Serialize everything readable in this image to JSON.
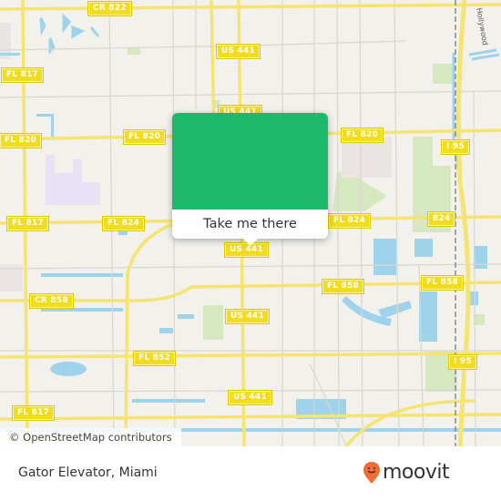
{
  "map": {
    "attribution": "© OpenStreetMap contributors",
    "colors": {
      "land": "#f2f1ec",
      "road_major": "#f6e470",
      "road_minor": "#d9d6cf",
      "water": "#9fd3ec",
      "park": "#d6e8bf",
      "shield": "#f1dc1e",
      "rail": "#8a8a8a"
    },
    "road_shields": [
      {
        "id": "cr822",
        "label": "CR 822"
      },
      {
        "id": "us441-a",
        "label": "US 441"
      },
      {
        "id": "fl817-a",
        "label": "FL 817"
      },
      {
        "id": "us441-b",
        "label": "US 441"
      },
      {
        "id": "fl820-a",
        "label": "FL 820"
      },
      {
        "id": "fl820-b",
        "label": "FL 820"
      },
      {
        "id": "fl820-c",
        "label": "FL 820"
      },
      {
        "id": "i95-a",
        "label": "I 95"
      },
      {
        "id": "fl817-b",
        "label": "FL 817"
      },
      {
        "id": "fl824-a",
        "label": "FL 824"
      },
      {
        "id": "fl824-b",
        "label": "FL 824"
      },
      {
        "id": "r824",
        "label": "824"
      },
      {
        "id": "us441-c",
        "label": "US 441"
      },
      {
        "id": "cr858",
        "label": "CR 858"
      },
      {
        "id": "fl858-a",
        "label": "FL 858"
      },
      {
        "id": "fl858-b",
        "label": "FL 858"
      },
      {
        "id": "us441-d",
        "label": "US 441"
      },
      {
        "id": "fl852",
        "label": "FL 852"
      },
      {
        "id": "i95-b",
        "label": "I 95"
      },
      {
        "id": "us441-e",
        "label": "US 441"
      },
      {
        "id": "fl817-c",
        "label": "FL 817"
      }
    ],
    "street_label": "Hollywood"
  },
  "popup": {
    "button_label": "Take me there",
    "accent_color": "#1eb86a"
  },
  "footer": {
    "place_name": "Gator Elevator, Miami",
    "logo_text": "moovit",
    "logo_color": "#f26a36"
  }
}
